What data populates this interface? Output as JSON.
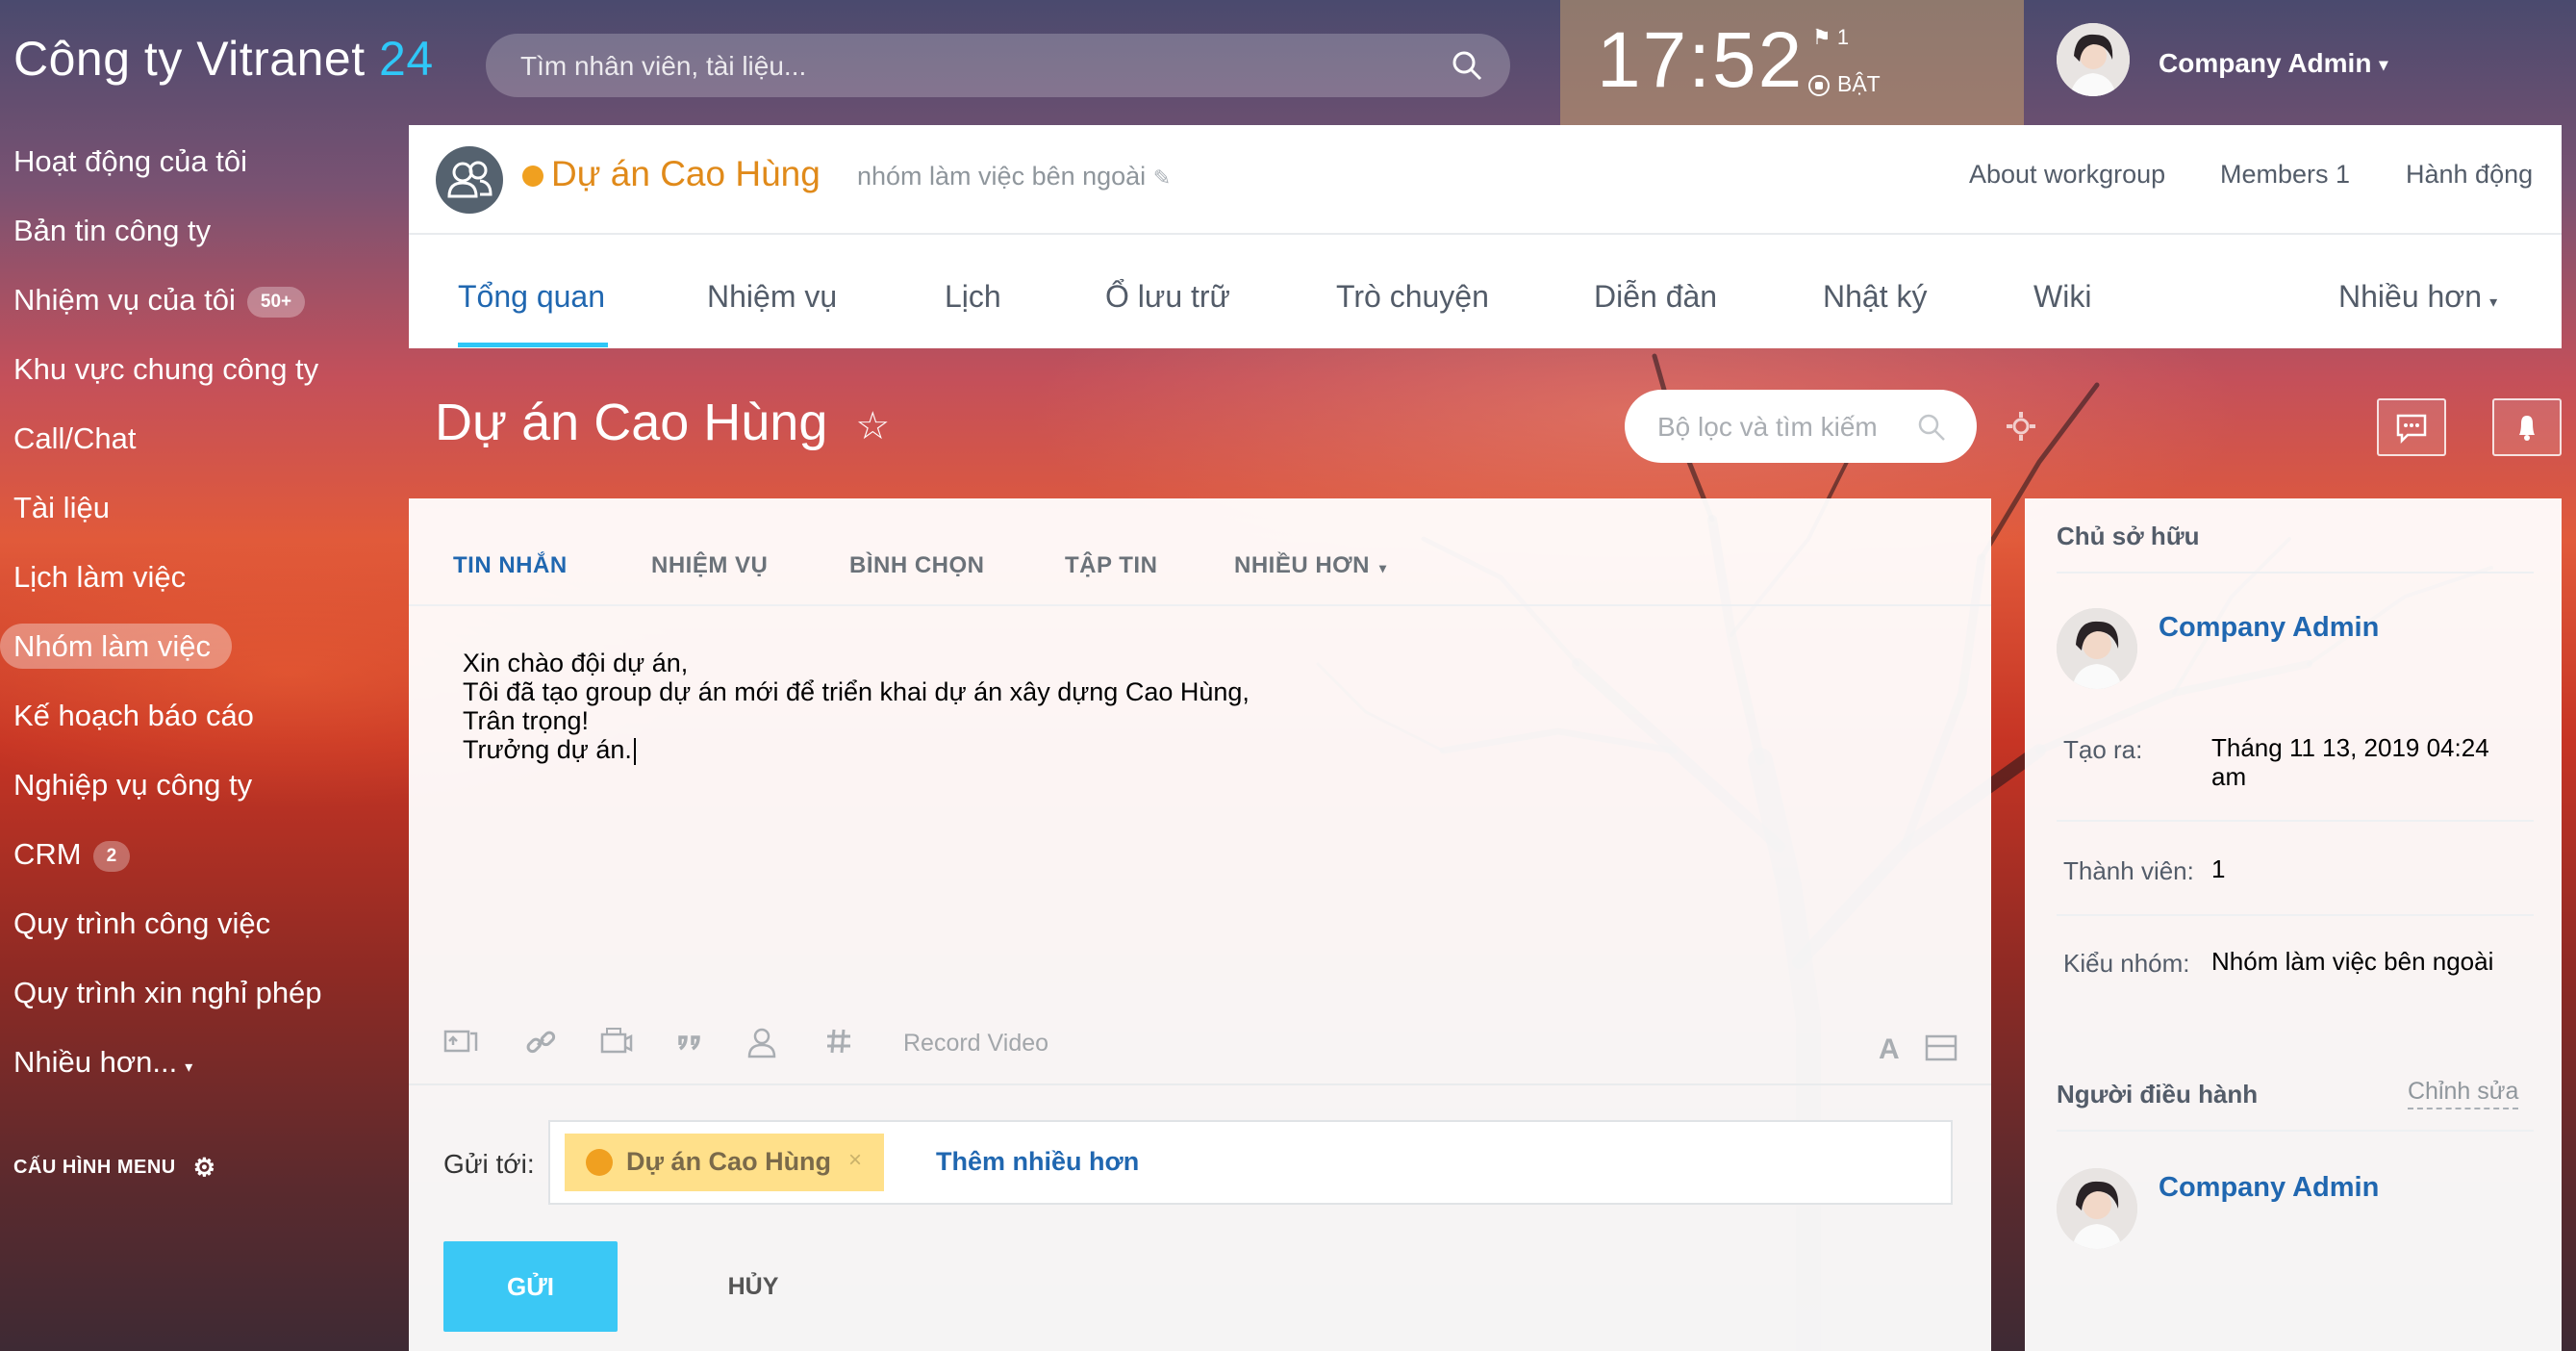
{
  "header": {
    "logo_text": "Công ty Vitranet",
    "logo_number": "24",
    "search_placeholder": "Tìm nhân viên, tài liệu...",
    "clock": "17:52",
    "flag_count": "1",
    "status_label": "BẬT",
    "user_name": "Company Admin",
    "accent_color": "#2fc7f7"
  },
  "sidebar": {
    "items": [
      {
        "label": "Hoạt động của tôi"
      },
      {
        "label": "Bản tin công ty"
      },
      {
        "label": "Nhiệm vụ của tôi",
        "badge": "50+"
      },
      {
        "label": "Khu vực chung công ty"
      },
      {
        "label": "Call/Chat"
      },
      {
        "label": "Tài liệu"
      },
      {
        "label": "Lịch làm việc"
      },
      {
        "label": "Nhóm làm việc"
      },
      {
        "label": "Kế hoạch báo cáo"
      },
      {
        "label": "Nghiệp vụ công ty"
      },
      {
        "label": "CRM",
        "badge": "2"
      },
      {
        "label": "Quy trình công việc"
      },
      {
        "label": "Quy trình xin nghỉ phép"
      },
      {
        "label": "Nhiều hơn..."
      }
    ],
    "config_label": "CẤU HÌNH MENU"
  },
  "group": {
    "title": "Dự án Cao Hùng",
    "subtitle": "nhóm làm việc bên ngoài",
    "links": [
      "About workgroup",
      "Members 1",
      "Hành động"
    ],
    "tabs": [
      "Tổng quan",
      "Nhiệm vụ",
      "Lịch",
      "Ổ lưu trữ",
      "Trò chuyện",
      "Diễn đàn",
      "Nhật ký",
      "Wiki",
      "Nhiều hơn"
    ]
  },
  "page": {
    "title": "Dự án Cao Hùng",
    "filter_placeholder": "Bộ lọc và tìm kiếm"
  },
  "composer": {
    "tabs": [
      "TIN NHẮN",
      "NHIỆM VỤ",
      "BÌNH CHỌN",
      "TẬP TIN",
      "NHIỀU HƠN"
    ],
    "message_lines": [
      "Xin chào đội dự án,",
      "Tôi đã tạo group dự án mới để triển khai dự án xây dựng Cao Hùng,",
      "Trân trọng!",
      "Trưởng dự án."
    ],
    "record_video": "Record Video",
    "send_to_label": "Gửi tới:",
    "destination": "Dự án Cao Hùng",
    "add_more": "Thêm nhiều hơn",
    "send_label": "GỬI",
    "cancel_label": "HỦY"
  },
  "panel": {
    "owner_title": "Chủ sở hữu",
    "owner_name": "Company Admin",
    "created_key": "Tạo ra:",
    "created_val": "Tháng 11 13, 2019 04:24 am",
    "members_key": "Thành viên:",
    "members_val": "1",
    "type_key": "Kiểu nhóm:",
    "type_val": "Nhóm làm việc bên ngoài",
    "moderator_title": "Người điều hành",
    "edit_label": "Chỉnh sửa",
    "moderator_name": "Company Admin"
  }
}
